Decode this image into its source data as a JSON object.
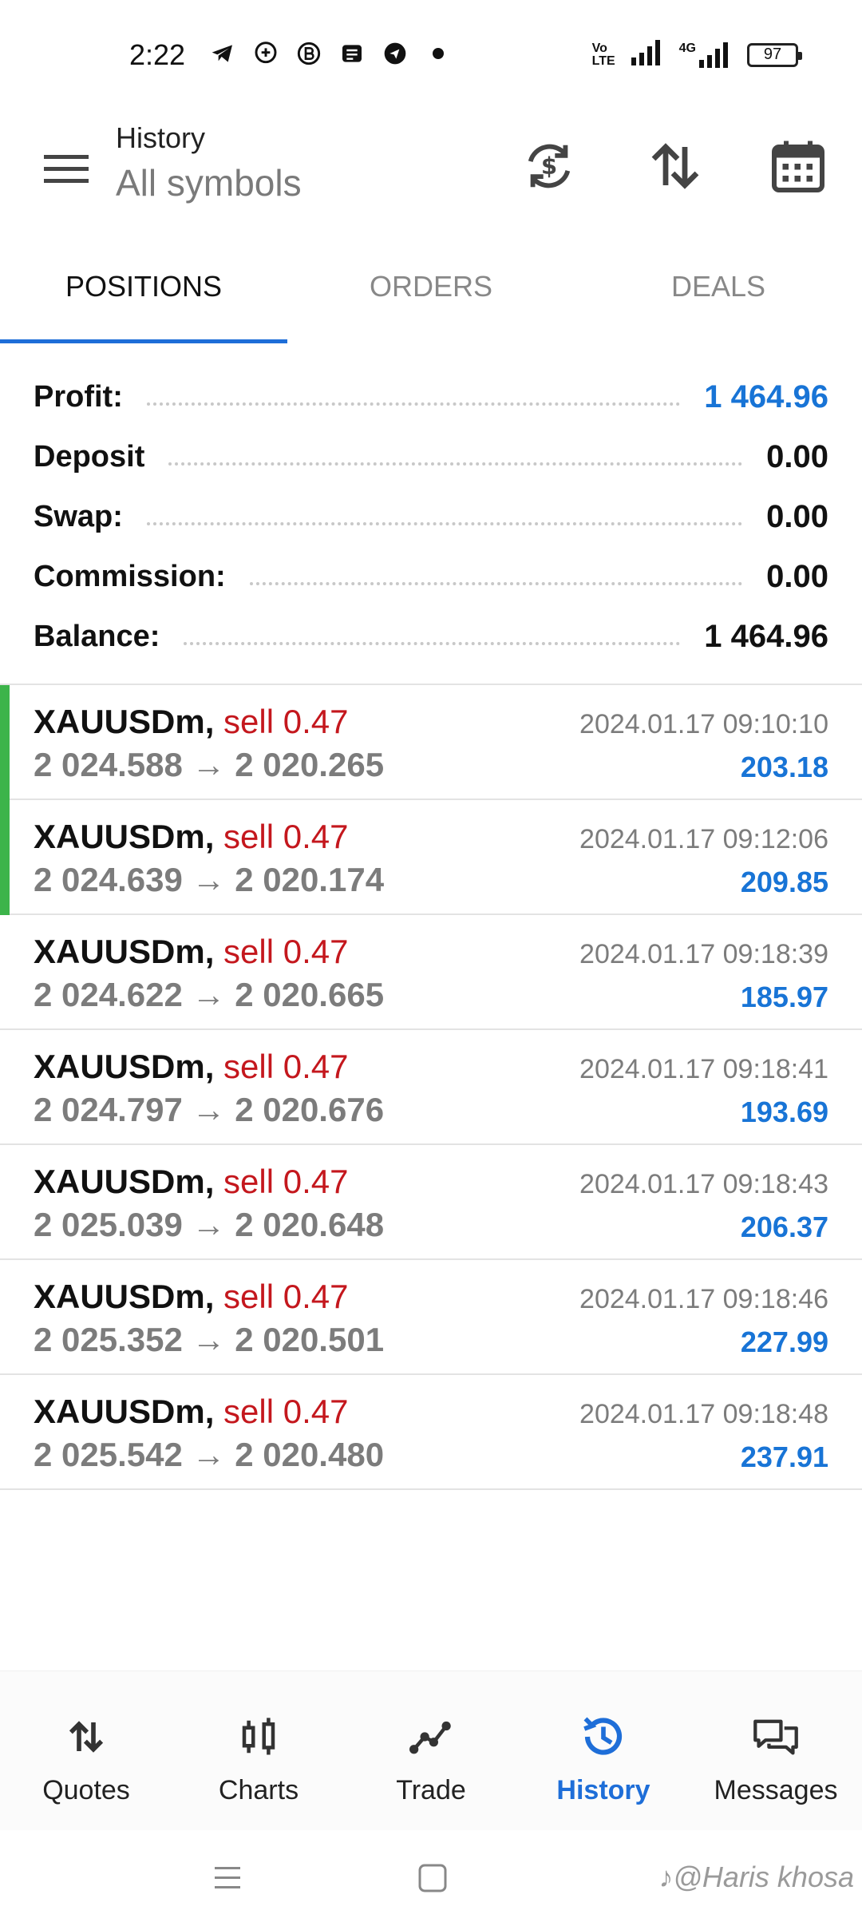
{
  "status_bar": {
    "time": "2:22",
    "net_label_1": "Vo",
    "net_label_2": "LTE",
    "net_label_3": "4G",
    "battery": "97"
  },
  "header": {
    "title": "History",
    "subtitle": "All symbols"
  },
  "tabs": [
    {
      "label": "POSITIONS",
      "active": true
    },
    {
      "label": "ORDERS",
      "active": false
    },
    {
      "label": "DEALS",
      "active": false
    }
  ],
  "summary": [
    {
      "label": "Profit:",
      "value": "1 464.96",
      "highlight": true
    },
    {
      "label": "Deposit",
      "value": "0.00",
      "highlight": false
    },
    {
      "label": "Swap:",
      "value": "0.00",
      "highlight": false
    },
    {
      "label": "Commission:",
      "value": "0.00",
      "highlight": false
    },
    {
      "label": "Balance:",
      "value": "1 464.96",
      "highlight": false
    }
  ],
  "deals": [
    {
      "symbol": "XAUUSDm",
      "side": "sell 0.47",
      "open": "2 024.588",
      "close": "2 020.265",
      "time": "2024.01.17 09:10:10",
      "profit": "203.18",
      "marked": true
    },
    {
      "symbol": "XAUUSDm",
      "side": "sell 0.47",
      "open": "2 024.639",
      "close": "2 020.174",
      "time": "2024.01.17 09:12:06",
      "profit": "209.85",
      "marked": true
    },
    {
      "symbol": "XAUUSDm",
      "side": "sell 0.47",
      "open": "2 024.622",
      "close": "2 020.665",
      "time": "2024.01.17 09:18:39",
      "profit": "185.97",
      "marked": false
    },
    {
      "symbol": "XAUUSDm",
      "side": "sell 0.47",
      "open": "2 024.797",
      "close": "2 020.676",
      "time": "2024.01.17 09:18:41",
      "profit": "193.69",
      "marked": false
    },
    {
      "symbol": "XAUUSDm",
      "side": "sell 0.47",
      "open": "2 025.039",
      "close": "2 020.648",
      "time": "2024.01.17 09:18:43",
      "profit": "206.37",
      "marked": false
    },
    {
      "symbol": "XAUUSDm",
      "side": "sell 0.47",
      "open": "2 025.352",
      "close": "2 020.501",
      "time": "2024.01.17 09:18:46",
      "profit": "227.99",
      "marked": false
    },
    {
      "symbol": "XAUUSDm",
      "side": "sell 0.47",
      "open": "2 025.542",
      "close": "2 020.480",
      "time": "2024.01.17 09:18:48",
      "profit": "237.91",
      "marked": false
    }
  ],
  "arrow": "→",
  "bottom_nav": [
    {
      "label": "Quotes",
      "icon": "quotes-arrows-icon",
      "active": false
    },
    {
      "label": "Charts",
      "icon": "candlestick-icon",
      "active": false
    },
    {
      "label": "Trade",
      "icon": "trade-line-icon",
      "active": false
    },
    {
      "label": "History",
      "icon": "history-clock-icon",
      "active": true
    },
    {
      "label": "Messages",
      "icon": "messages-icon",
      "active": false
    }
  ],
  "watermark": "@Haris khosa",
  "colors": {
    "accent": "#1e6ed8",
    "profit_blue": "#1874d6",
    "sell_red": "#c4171d",
    "marker_green": "#3cb44a"
  }
}
